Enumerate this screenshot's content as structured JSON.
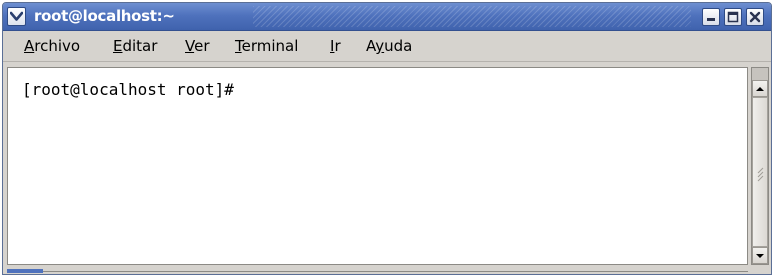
{
  "window": {
    "title": "root@localhost:~"
  },
  "menubar": {
    "items": [
      {
        "label_underlined": "A",
        "label_rest": "rchivo"
      },
      {
        "label_underlined": "E",
        "label_rest": "ditar"
      },
      {
        "label_underlined": "V",
        "label_rest": "er"
      },
      {
        "label_underlined": "T",
        "label_rest": "erminal"
      },
      {
        "label_underlined": "I",
        "label_rest": "r"
      },
      {
        "label_before": "A",
        "label_underlined": "y",
        "label_rest": "uda"
      }
    ]
  },
  "terminal": {
    "prompt": "[root@localhost root]#"
  },
  "icons": {
    "window_menu": "chevron-down-icon",
    "minimize": "minimize-icon",
    "maximize": "maximize-icon",
    "close": "close-icon",
    "scroll_up": "arrow-up-icon",
    "scroll_down": "arrow-down-icon"
  },
  "colors": {
    "titlebar": "#4f72bd",
    "window_bg": "#d6d3ce",
    "terminal_bg": "#ffffff"
  }
}
